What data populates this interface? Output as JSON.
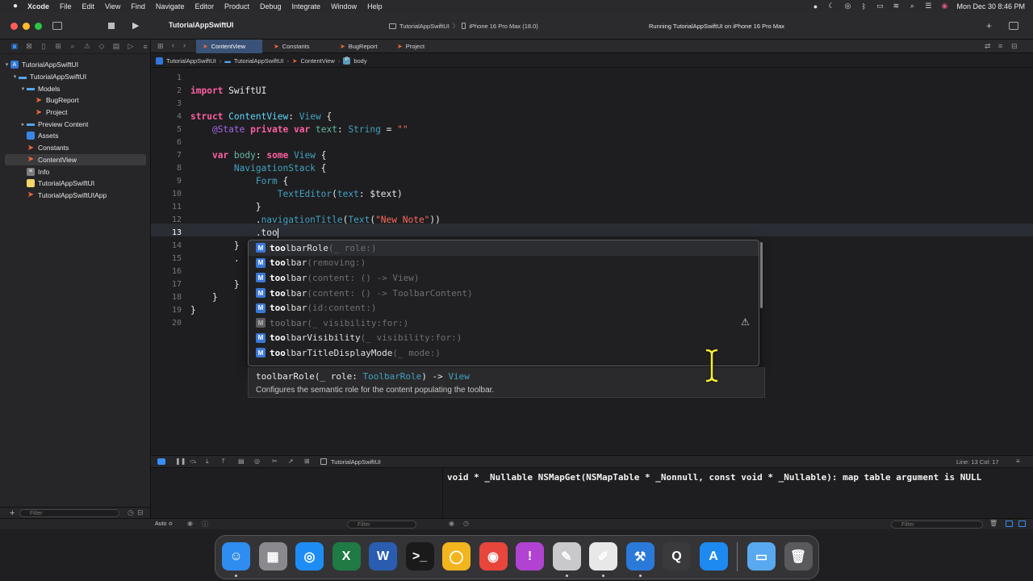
{
  "menubar": {
    "app": "Xcode",
    "items": [
      "File",
      "Edit",
      "View",
      "Find",
      "Navigate",
      "Editor",
      "Product",
      "Debug",
      "Integrate",
      "Window",
      "Help"
    ],
    "clock": "Mon Dec 30  8:46 PM"
  },
  "toolbar": {
    "project_title": "TutorialAppSwiftUI",
    "scheme": "TutorialAppSwiftUI",
    "destination": "iPhone 16 Pro Max (18.0)",
    "status": "Running TutorialAppSwiftUI on iPhone 16 Pro Max"
  },
  "navigator": {
    "tree": [
      {
        "label": "TutorialAppSwiftUI",
        "depth": 0,
        "icon": "project-icon",
        "disclosure": "▾"
      },
      {
        "label": "TutorialAppSwiftUI",
        "depth": 1,
        "icon": "folder-icon",
        "disclosure": "▾"
      },
      {
        "label": "Models",
        "depth": 2,
        "icon": "folder-icon",
        "disclosure": "▾"
      },
      {
        "label": "BugReport",
        "depth": 3,
        "icon": "swift-file-icon",
        "disclosure": ""
      },
      {
        "label": "Project",
        "depth": 3,
        "icon": "swift-file-icon",
        "disclosure": ""
      },
      {
        "label": "Preview Content",
        "depth": 2,
        "icon": "folder-icon",
        "disclosure": "▸"
      },
      {
        "label": "Assets",
        "depth": 2,
        "icon": "assets-icon",
        "disclosure": ""
      },
      {
        "label": "Constants",
        "depth": 2,
        "icon": "swift-file-icon",
        "disclosure": ""
      },
      {
        "label": "ContentView",
        "depth": 2,
        "icon": "swift-file-icon",
        "disclosure": "",
        "selected": true
      },
      {
        "label": "Info",
        "depth": 2,
        "icon": "info-plist-icon",
        "disclosure": ""
      },
      {
        "label": "TutorialAppSwiftUI",
        "depth": 2,
        "icon": "entitlements-icon",
        "disclosure": ""
      },
      {
        "label": "TutorialAppSwiftUIApp",
        "depth": 2,
        "icon": "swift-file-icon",
        "disclosure": ""
      }
    ],
    "filter_placeholder": "Filter"
  },
  "tabs": [
    "ContentView",
    "Constants",
    "BugReport",
    "Project"
  ],
  "jumpbar": [
    "TutorialAppSwiftUI",
    "TutorialAppSwiftUI",
    "ContentView",
    "body"
  ],
  "code": {
    "current_line": 13,
    "lines": [
      {
        "n": "1",
        "text": ""
      },
      {
        "n": "2",
        "text": "import SwiftUI"
      },
      {
        "n": "3",
        "text": ""
      },
      {
        "n": "4",
        "text": "struct ContentView: View {"
      },
      {
        "n": "5",
        "text": "    @State private var text: String = \"\""
      },
      {
        "n": "6",
        "text": ""
      },
      {
        "n": "7",
        "text": "    var body: some View {"
      },
      {
        "n": "8",
        "text": "        NavigationStack {"
      },
      {
        "n": "9",
        "text": "            Form {"
      },
      {
        "n": "10",
        "text": "                TextEditor(text: $text)"
      },
      {
        "n": "11",
        "text": "            }"
      },
      {
        "n": "12",
        "text": "            .navigationTitle(Text(\"New Note\"))"
      },
      {
        "n": "13",
        "text": "            .too"
      },
      {
        "n": "14",
        "text": "        }"
      },
      {
        "n": "15",
        "text": "        ."
      },
      {
        "n": "16",
        "text": ""
      },
      {
        "n": "17",
        "text": "        }"
      },
      {
        "n": "18",
        "text": "    }"
      },
      {
        "n": "19",
        "text": "}"
      },
      {
        "n": "20",
        "text": ""
      }
    ]
  },
  "autocomplete": {
    "typed": "too",
    "items": [
      {
        "kind": "M",
        "match": "too",
        "rest": "lbarRole",
        "params": "(_ role:)",
        "selected": true
      },
      {
        "kind": "M",
        "match": "too",
        "rest": "lbar",
        "params": "(removing:)"
      },
      {
        "kind": "M",
        "match": "too",
        "rest": "lbar",
        "params": "(content: () -> View)"
      },
      {
        "kind": "M",
        "match": "too",
        "rest": "lbar",
        "params": "(content: () -> ToolbarContent)"
      },
      {
        "kind": "M",
        "match": "too",
        "rest": "lbar",
        "params": "(id:content:)"
      },
      {
        "kind": "M",
        "match": "too",
        "rest": "lbar",
        "params": "(_ visibility:for:)",
        "deprecated": true
      },
      {
        "kind": "M",
        "match": "too",
        "rest": "lbarVisibility",
        "params": "(_ visibility:for:)"
      },
      {
        "kind": "M",
        "match": "too",
        "rest": "lbarTitleDisplayMode",
        "params": "(_ mode:)"
      }
    ],
    "doc_signature_name": "toolbarRole(_ role: ",
    "doc_signature_type": "ToolbarRole",
    "doc_signature_arrow": ") -> ",
    "doc_signature_return": "View",
    "doc_description": "Configures the semantic role for the content populating the toolbar."
  },
  "debug": {
    "target": "TutorialAppSwiftUI",
    "position": "Line: 13  Col: 17",
    "console_text": "void * _Nullable NSMapGet(NSMapTable * _Nonnull, const void * _Nullable): map table argument is NULL",
    "auto_label": "Auto ≎",
    "filter_placeholder": "Filter"
  },
  "dock": [
    {
      "name": "finder-icon",
      "glyph": "☺",
      "color": "#2f8cf0"
    },
    {
      "name": "launchpad-icon",
      "glyph": "▦",
      "color": "#8a8a8e"
    },
    {
      "name": "safari-icon",
      "glyph": "◎",
      "color": "#1d8df5"
    },
    {
      "name": "excel-icon",
      "glyph": "X",
      "color": "#1f7a44"
    },
    {
      "name": "word-icon",
      "glyph": "W",
      "color": "#2a5db0"
    },
    {
      "name": "terminal-icon",
      "glyph": ">_",
      "color": "#1a1a1a"
    },
    {
      "name": "keynote-icon",
      "glyph": "◯",
      "color": "#f2b51d"
    },
    {
      "name": "chrome-icon",
      "glyph": "◉",
      "color": "#e8453c"
    },
    {
      "name": "feedback-icon",
      "glyph": "!",
      "color": "#b043d1"
    },
    {
      "name": "notes-pencil-icon",
      "glyph": "✎",
      "color": "#c9c9cc"
    },
    {
      "name": "textedit-icon",
      "glyph": "✐",
      "color": "#e8e8e8"
    },
    {
      "name": "xcode-icon",
      "glyph": "⚒",
      "color": "#2b79d8"
    },
    {
      "name": "quicktime-icon",
      "glyph": "Q",
      "color": "#3a3a3c"
    },
    {
      "name": "app-store-icon",
      "glyph": "A",
      "color": "#1c8af0"
    },
    {
      "name": "downloads-folder-icon",
      "glyph": "▭",
      "color": "#58a9ef"
    },
    {
      "name": "trash-icon",
      "glyph": "🗑",
      "color": "#5a5a5e"
    }
  ]
}
